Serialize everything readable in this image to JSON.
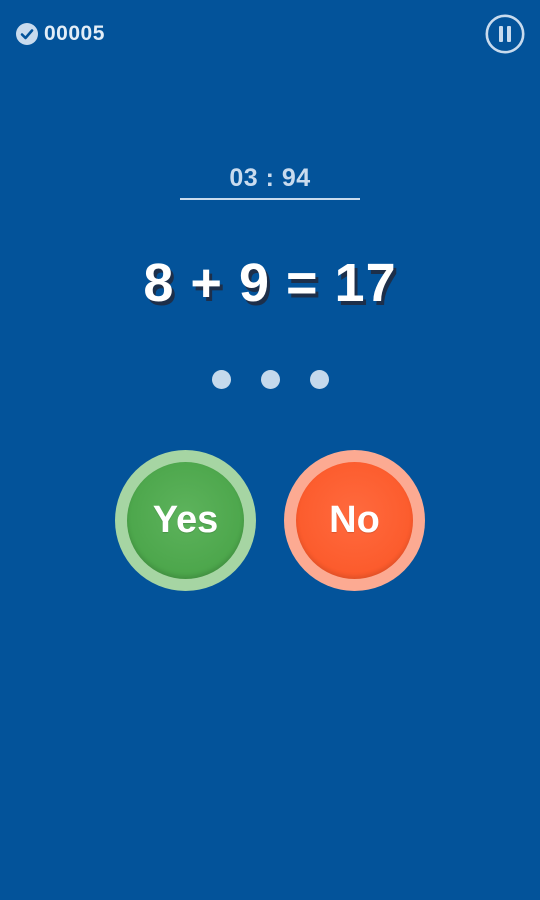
{
  "score": {
    "value": "00005",
    "icon": "check-circle-icon"
  },
  "pause": {
    "icon": "pause-icon"
  },
  "timer": {
    "text": "03 : 94"
  },
  "equation": {
    "text": "8 + 9 = 17"
  },
  "progress_dots": {
    "count": 3
  },
  "answers": {
    "yes_label": "Yes",
    "no_label": "No"
  },
  "colors": {
    "background": "#03539A",
    "yes_ring": "#A6D5A3",
    "yes_fill": "#4CA64B",
    "no_ring": "#FCAA92",
    "no_fill": "#FC5B2C",
    "equation_shadow": "#1D2F4A"
  }
}
